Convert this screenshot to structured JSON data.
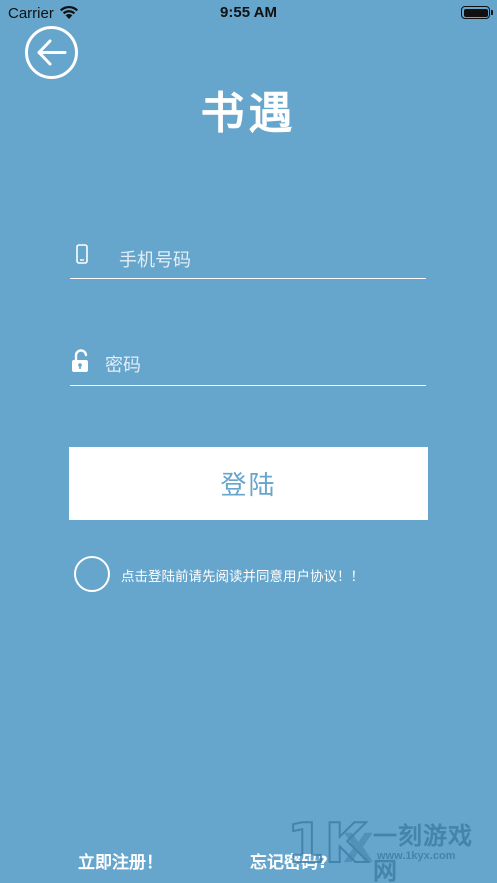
{
  "status_bar": {
    "carrier": "Carrier",
    "time": "9:55 AM"
  },
  "header": {
    "title": "书遇"
  },
  "form": {
    "phone_placeholder": "手机号码",
    "password_placeholder": "密码",
    "login_label": "登陆",
    "agreement_text": "点击登陆前请先阅读并同意用户协议！！"
  },
  "footer": {
    "register_label": "立即注册！",
    "forgot_label": "忘记密码?"
  },
  "watermark": {
    "text": "一刻游戏网",
    "url": "www.1kyx.com"
  },
  "colors": {
    "background": "#66a5cc",
    "button_bg": "#ffffff",
    "button_text": "#66a5cc"
  }
}
